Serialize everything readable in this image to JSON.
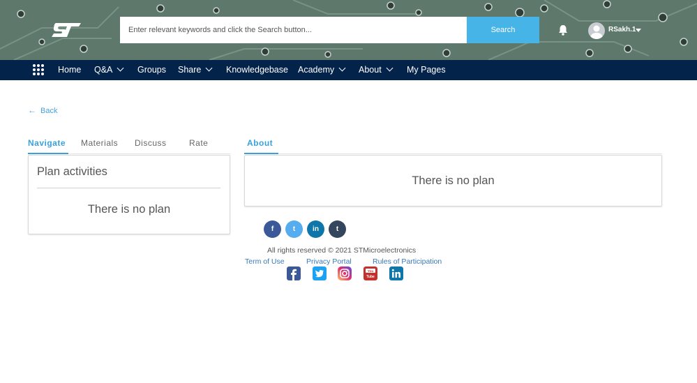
{
  "header": {
    "logo_icon": "st-logo",
    "search": {
      "placeholder": "Enter relevant keywords and click the Search button...",
      "button_label": "Search"
    },
    "notifications_icon": "bell-icon",
    "user": {
      "name": "RSakh.1",
      "avatar_icon": "user-avatar-icon"
    }
  },
  "nav": {
    "apps_icon": "grid-icon",
    "items": [
      {
        "label": "Home",
        "has_menu": false
      },
      {
        "label": "Q&A",
        "has_menu": true
      },
      {
        "label": "Groups",
        "has_menu": false
      },
      {
        "label": "Share",
        "has_menu": true
      },
      {
        "label": "Knowledgebase",
        "has_menu": false
      },
      {
        "label": "Academy",
        "has_menu": true
      },
      {
        "label": "About",
        "has_menu": true
      },
      {
        "label": "My Pages",
        "has_menu": false
      }
    ]
  },
  "back_link": {
    "label": "Back",
    "icon": "arrow-left-icon"
  },
  "left_tabs": [
    {
      "label": "Navigate",
      "active": true
    },
    {
      "label": "Materials",
      "active": false
    },
    {
      "label": "Discuss",
      "active": false
    },
    {
      "label": "Rate",
      "active": false
    }
  ],
  "right_tabs": [
    {
      "label": "About",
      "active": true
    }
  ],
  "plan_panel": {
    "title": "Plan activities",
    "empty_text": "There is no plan"
  },
  "about_panel": {
    "empty_text": "There is no plan"
  },
  "share_buttons": [
    {
      "icon": "facebook-icon",
      "glyph": "f",
      "color": "#3b5998"
    },
    {
      "icon": "twitter-icon",
      "glyph": "t",
      "color": "#55acee"
    },
    {
      "icon": "linkedin-icon",
      "glyph": "in",
      "color": "#0e76a8"
    },
    {
      "icon": "tumblr-icon",
      "glyph": "t",
      "color": "#34465d"
    }
  ],
  "footer": {
    "copyright": "All rights reserved © 2021 STMicroelectronics",
    "links": [
      "Term of Use",
      "Privacy Portal",
      "Rules of Participation"
    ],
    "social_icons": [
      {
        "icon": "facebook-icon",
        "color": "#3b5998"
      },
      {
        "icon": "twitter-icon",
        "color": "#1da1f2"
      },
      {
        "icon": "instagram-icon",
        "color": "#d6249f"
      },
      {
        "icon": "youtube-icon",
        "color": "#c4302b"
      },
      {
        "icon": "linkedin-icon",
        "color": "#0e76a8"
      }
    ]
  },
  "colors": {
    "nav_bg": "#03234b",
    "accent": "#3aa0dc",
    "search_button": "#47b4e8",
    "link": "#3a78b8"
  }
}
